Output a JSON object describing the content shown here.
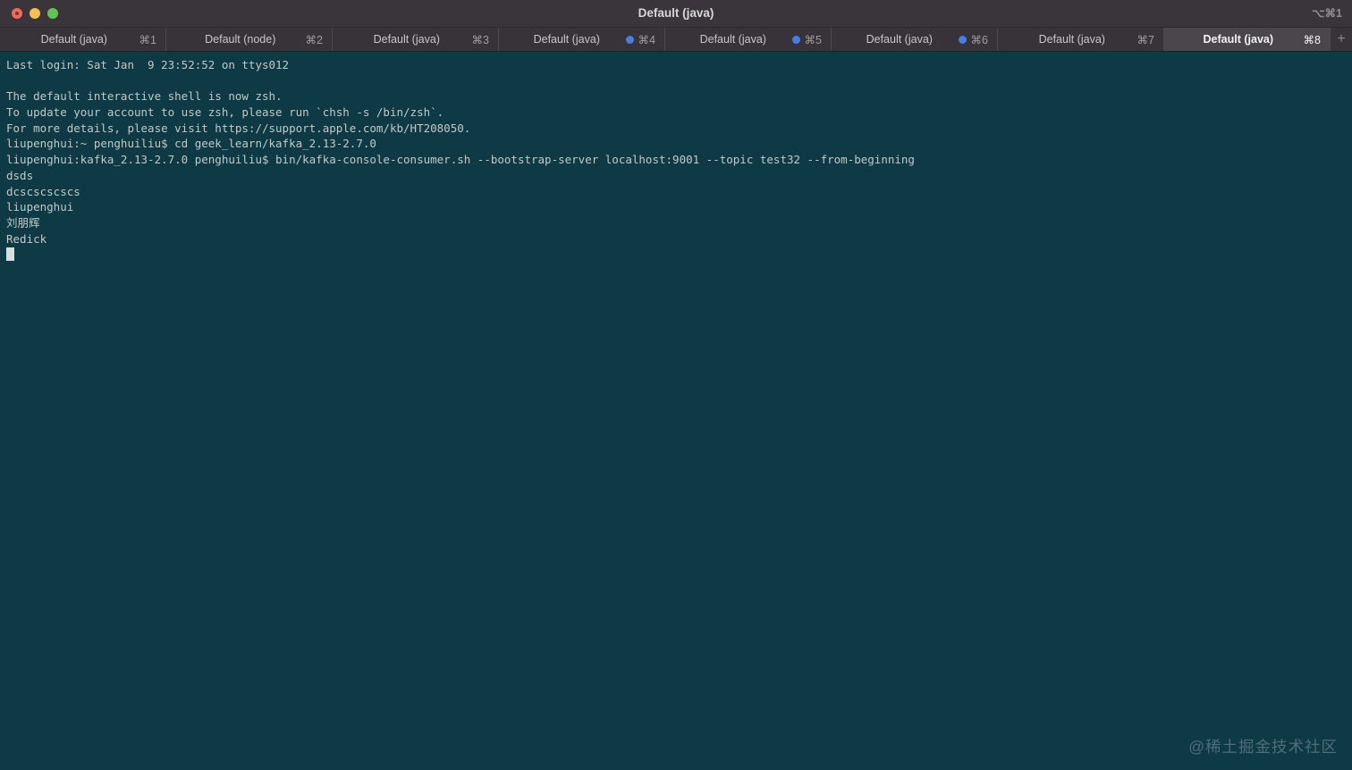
{
  "window": {
    "title": "Default (java)",
    "title_shortcut": "⌥⌘1"
  },
  "tab_bar": {
    "new_tab_label": "+",
    "tabs": [
      {
        "label": "Default (java)",
        "shortcut": "⌘1",
        "dot": false,
        "active": false
      },
      {
        "label": "Default (node)",
        "shortcut": "⌘2",
        "dot": false,
        "active": false
      },
      {
        "label": "Default (java)",
        "shortcut": "⌘3",
        "dot": false,
        "active": false
      },
      {
        "label": "Default (java)",
        "shortcut": "⌘4",
        "dot": true,
        "active": false
      },
      {
        "label": "Default (java)",
        "shortcut": "⌘5",
        "dot": true,
        "active": false
      },
      {
        "label": "Default (java)",
        "shortcut": "⌘6",
        "dot": true,
        "active": false
      },
      {
        "label": "Default (java)",
        "shortcut": "⌘7",
        "dot": false,
        "active": false
      },
      {
        "label": "Default (java)",
        "shortcut": "⌘8",
        "dot": false,
        "active": true
      }
    ]
  },
  "terminal": {
    "lines": [
      "Last login: Sat Jan  9 23:52:52 on ttys012",
      "",
      "The default interactive shell is now zsh.",
      "To update your account to use zsh, please run `chsh -s /bin/zsh`.",
      "For more details, please visit https://support.apple.com/kb/HT208050.",
      "liupenghui:~ penghuiliu$ cd geek_learn/kafka_2.13-2.7.0",
      "liupenghui:kafka_2.13-2.7.0 penghuiliu$ bin/kafka-console-consumer.sh --bootstrap-server localhost:9001 --topic test32 --from-beginning",
      "dsds",
      "dcscscscscs",
      "liupenghui",
      "刘朋辉",
      "Redick"
    ],
    "cursor_visible": true
  },
  "watermark": "@稀土掘金技术社区",
  "colors": {
    "terminal_bg": "#0d3a44",
    "terminal_text": "#c2c9c6",
    "titlebar_bg": "#3a353a",
    "tabbar_bg": "#373338",
    "tab_active_bg": "#4a464b",
    "tab_text": "#c9c6c9",
    "tab_shortcut": "#a09da0",
    "tab_active_text": "#f2f2f2",
    "separator": "#4e4a4f",
    "dot_blue": "#4a7de0",
    "light_red": "#ed6a5e",
    "light_red_dot": "#8c2f25",
    "light_yellow": "#f5bf4f",
    "light_green": "#61c554",
    "title_text": "#d8d8d8",
    "title_shortcut_text": "#8f8c8f",
    "cursor": "#d9dedd",
    "watermark_text": "#4f6e78"
  }
}
